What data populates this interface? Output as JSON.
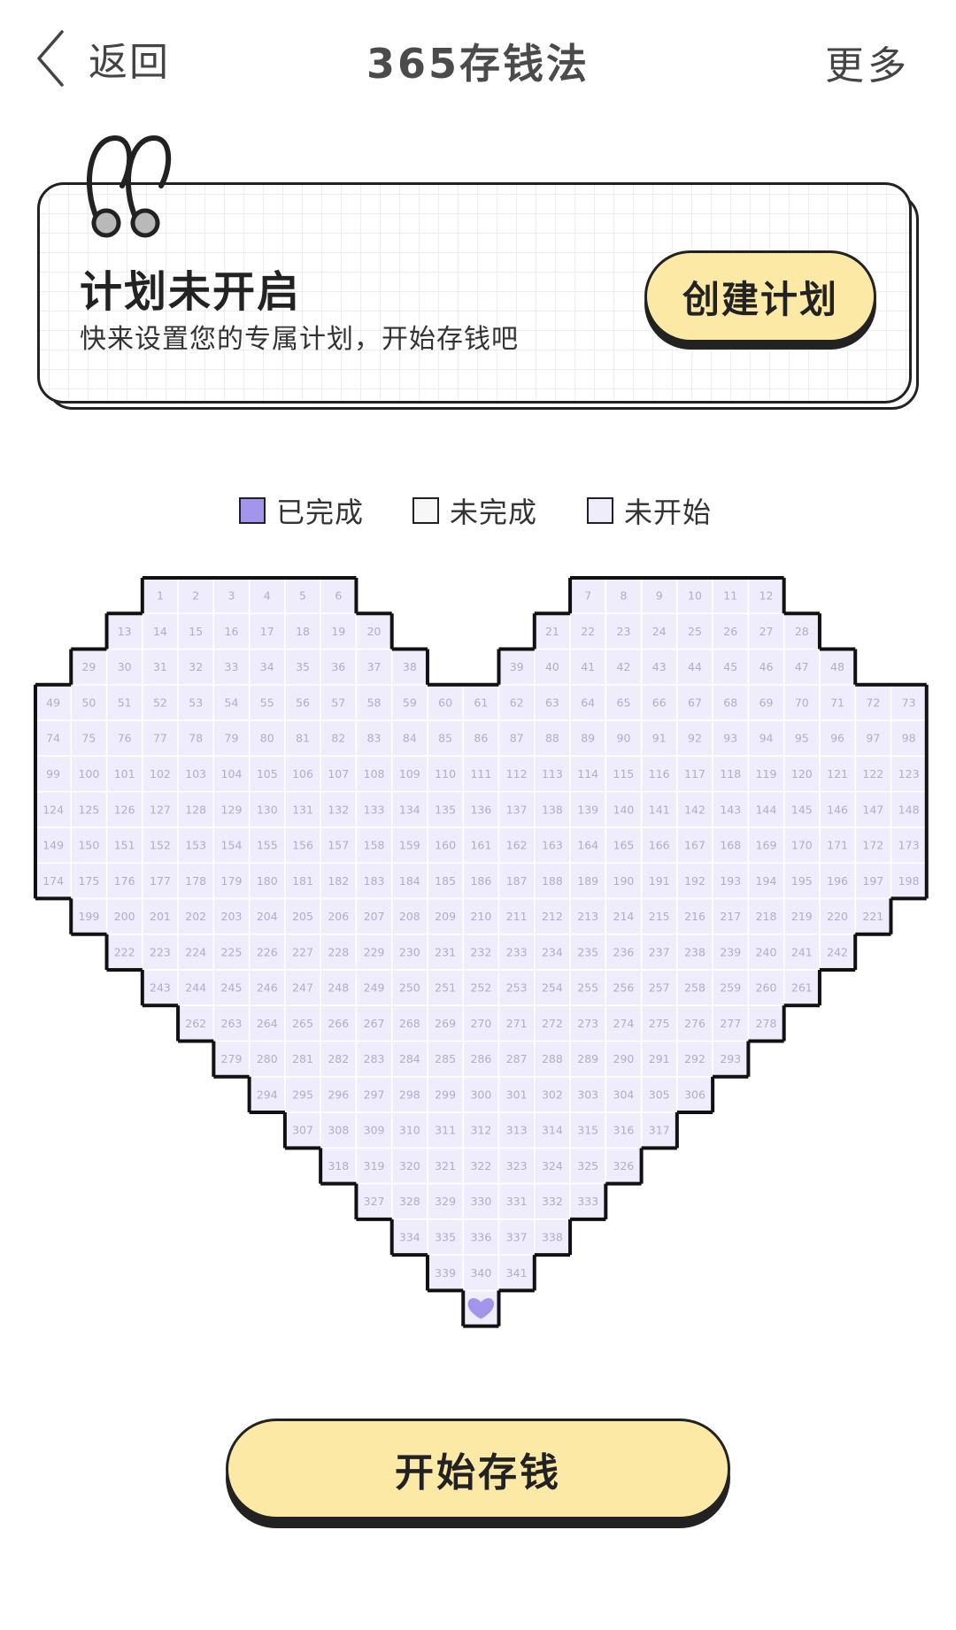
{
  "nav": {
    "back_label": "返回",
    "title": "365存钱法",
    "more_label": "更多"
  },
  "plan_card": {
    "title": "计划未开启",
    "subtitle": "快来设置您的专属计划，开始存钱吧",
    "create_button": "创建计划"
  },
  "legend": [
    {
      "label": "已完成",
      "color": "#a394ec"
    },
    {
      "label": "未完成",
      "color": "#f7f7f7"
    },
    {
      "label": "未开始",
      "color": "#efedfb"
    }
  ],
  "calendar": {
    "total_days": 365,
    "cell_color": "#efedfb",
    "grid_color": "#ffffff",
    "number_color": "#b2abd0",
    "heart_icon_color": "#a394ec"
  },
  "start_button": "开始存钱",
  "colors": {
    "button_yellow": "#fce9a6",
    "outline": "#222222"
  }
}
